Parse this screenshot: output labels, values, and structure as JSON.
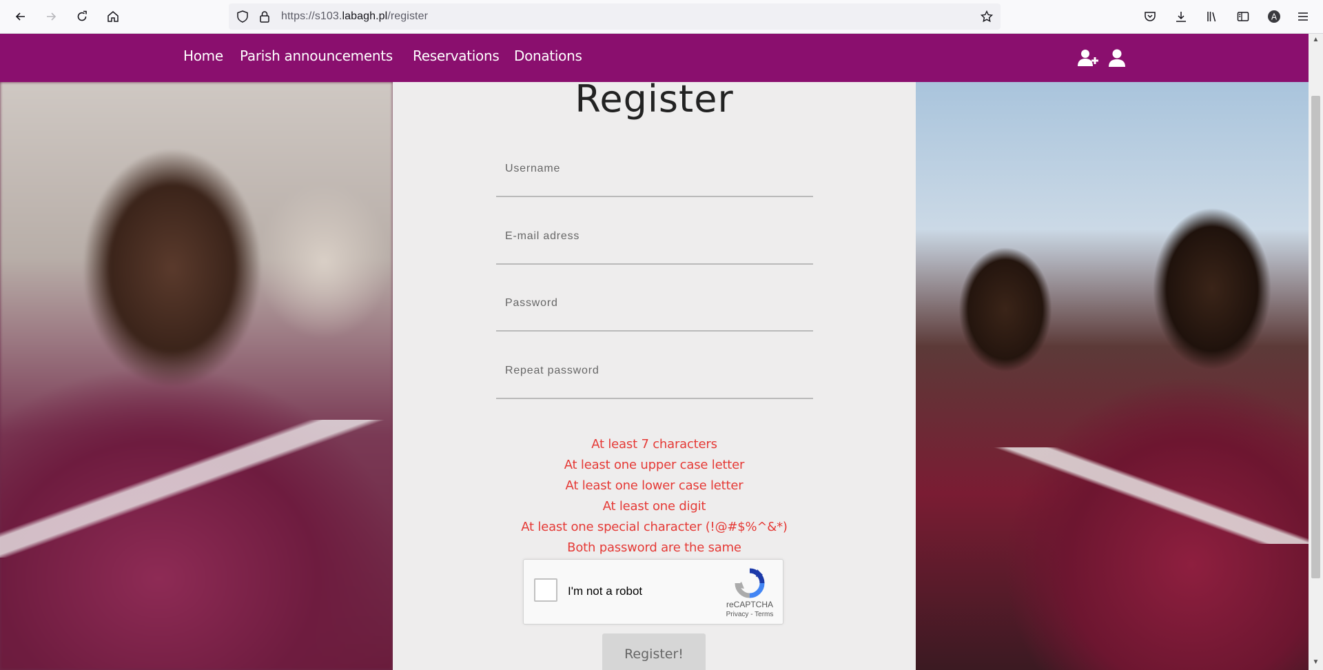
{
  "browser": {
    "url_prefix": "https://s103.",
    "url_host": "labagh.pl",
    "url_path": "/register"
  },
  "nav": {
    "home": "Home",
    "announcements": "Parish announcements",
    "reservations": "Reservations",
    "donations": "Donations"
  },
  "form": {
    "title": "Register",
    "username_label": "Username",
    "email_label": "E-mail adress",
    "password_label": "Password",
    "repeat_label": "Repeat password",
    "rules": [
      "At least 7 characters",
      "At least one upper case letter",
      "At least one lower case letter",
      "At least one digit",
      "At least one special character (!@#$%^&*)",
      "Both password are the same"
    ],
    "captcha": {
      "label": "I'm not a robot",
      "brand": "reCAPTCHA",
      "links": "Privacy - Terms"
    },
    "submit": "Register!"
  },
  "colors": {
    "navbar": "#8a0f6e",
    "rule_text": "#e53935",
    "panel": "#eeeded"
  }
}
